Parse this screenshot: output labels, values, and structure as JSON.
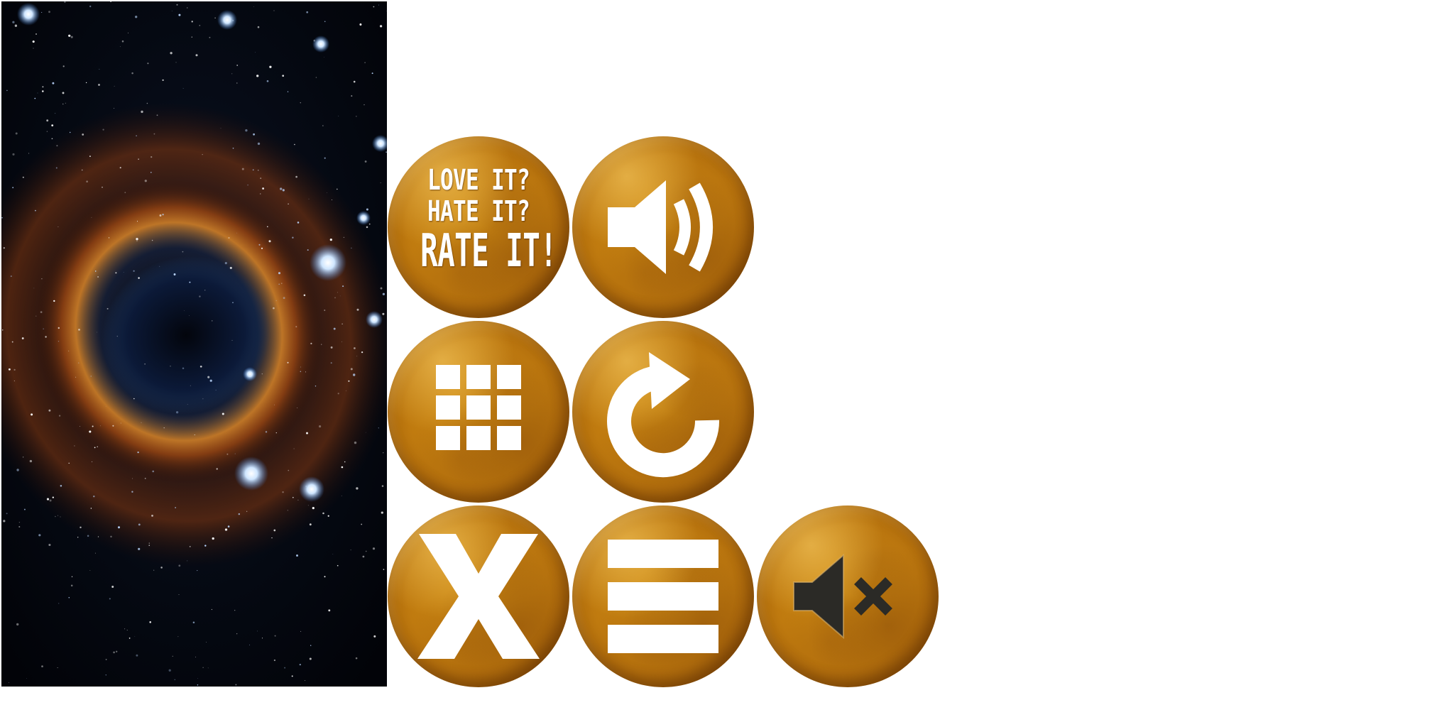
{
  "background_image": {
    "description_icon": "nebula-eye-icon"
  },
  "rate_button": {
    "line1": "LOVE IT?",
    "line2": "HATE IT?",
    "line3": "RATE IT!"
  },
  "buttons": [
    {
      "name": "rate-button",
      "icon": "rate-text"
    },
    {
      "name": "sound-on-button",
      "icon": "speaker-on-icon"
    },
    {
      "name": "level-grid-button",
      "icon": "grid-icon"
    },
    {
      "name": "restart-button",
      "icon": "restart-icon"
    },
    {
      "name": "close-button",
      "icon": "close-icon"
    },
    {
      "name": "menu-button",
      "icon": "menu-icon"
    },
    {
      "name": "sound-off-button",
      "icon": "speaker-muted-icon"
    }
  ],
  "colors": {
    "button_orange": "#c8840f",
    "icon_white": "#ffffff",
    "muted_icon_dark": "#2b2a26"
  }
}
